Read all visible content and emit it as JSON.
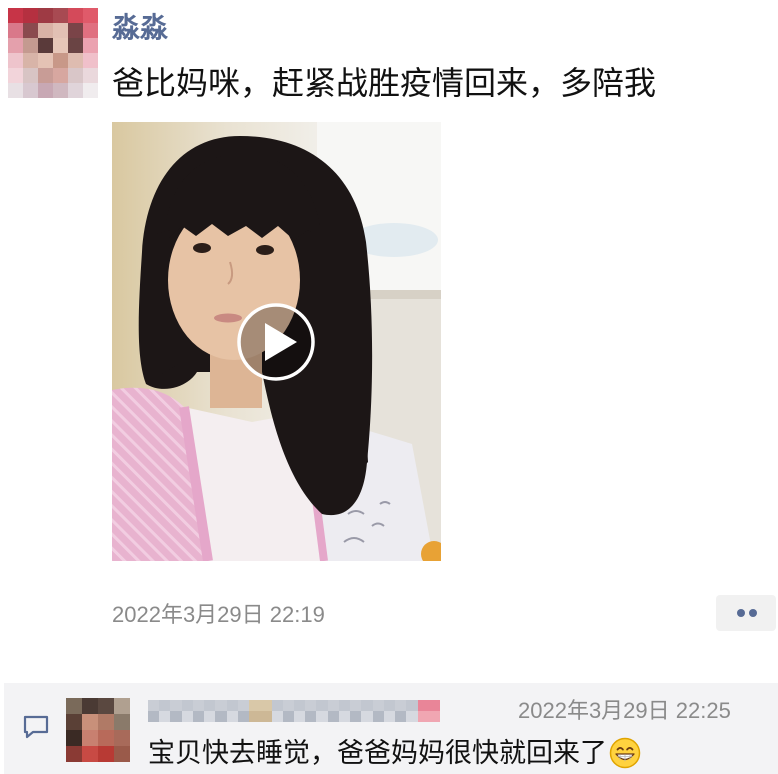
{
  "post": {
    "author_name": "淼淼",
    "text": "爸比妈咪，赶紧战胜疫情回来，多陪我",
    "video": {
      "overlay_icon": "play-icon"
    },
    "timestamp": "2022年3月29日 22:19",
    "more_icon": "more-dots-icon"
  },
  "comments": [
    {
      "time": "2022年3月29日 22:25",
      "text": "宝贝快去睡觉，爸爸妈妈很快就回来了",
      "trailing_emoji_icon": "grinning-face-emoji-icon"
    }
  ],
  "comment_section_icon": "comment-bubble-icon",
  "colors": {
    "link": "#576B95",
    "muted": "#8A8A8A",
    "comment_bg": "#F3F3F5",
    "text": "#111111"
  }
}
